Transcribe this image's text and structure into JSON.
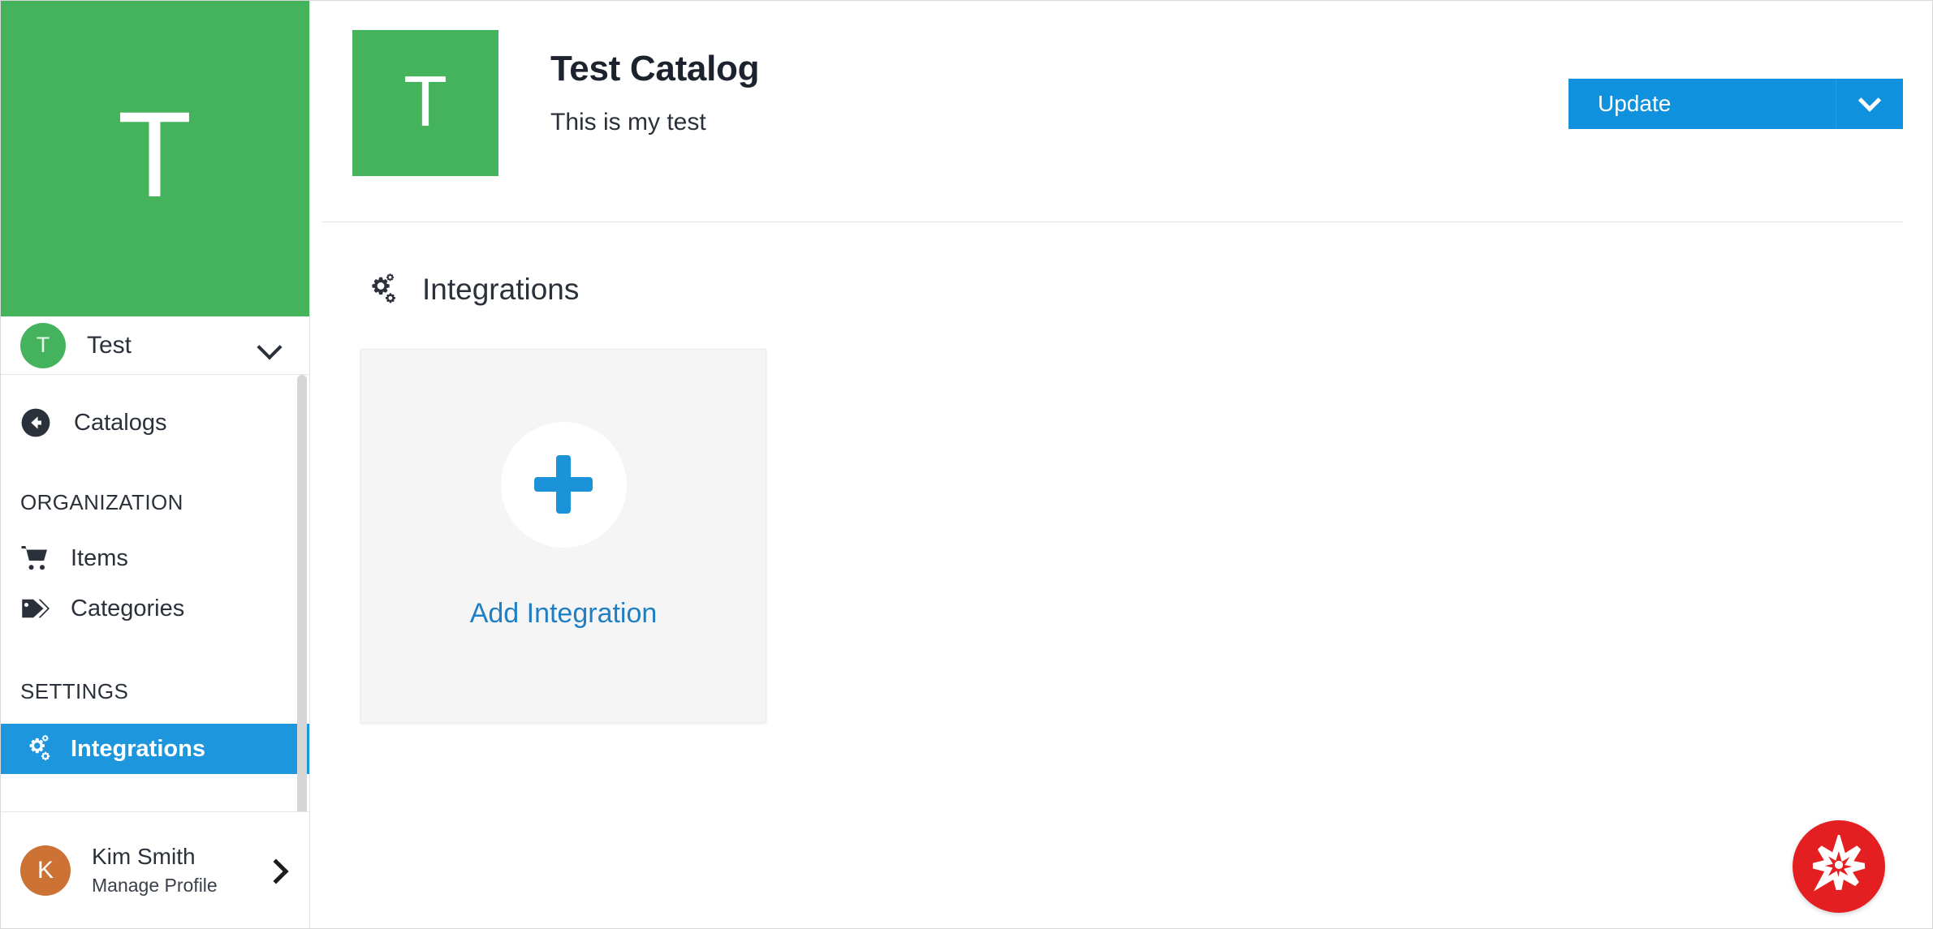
{
  "sidebar": {
    "brand": {
      "letter": "T",
      "color": "#44b35c"
    },
    "org_switcher": {
      "avatar_letter": "T",
      "avatar_color": "#45b35d",
      "name": "Test",
      "chevron_icon": "chevron-down-icon"
    },
    "back_item": {
      "label": "Catalogs",
      "icon": "arrow-circle-left-icon"
    },
    "sections": [
      {
        "title": "ORGANIZATION",
        "items": [
          {
            "label": "Items",
            "icon": "shopping-cart-icon",
            "active": false
          },
          {
            "label": "Categories",
            "icon": "tags-icon",
            "active": false
          }
        ]
      },
      {
        "title": "SETTINGS",
        "items": [
          {
            "label": "Integrations",
            "icon": "gears-icon",
            "active": true
          }
        ]
      }
    ],
    "active_item_color": "#1d96dd",
    "user": {
      "avatar_letter": "K",
      "avatar_color": "#cd7235",
      "name": "Kim Smith",
      "subtitle": "Manage Profile",
      "chevron_icon": "chevron-right-icon"
    },
    "scrollbar": {
      "name": "sidebar-scrollbar"
    }
  },
  "header": {
    "thumbnail_letter": "T",
    "thumbnail_color": "#44b35c",
    "title": "Test Catalog",
    "subtitle": "This is my test",
    "update_button": {
      "label": "Update",
      "color": "#1091de",
      "chevron_icon": "chevron-down-icon"
    }
  },
  "main": {
    "section": {
      "icon": "gears-icon",
      "title": "Integrations"
    },
    "add_card": {
      "label": "Add Integration",
      "plus_icon": "plus-icon",
      "accent_color": "#1f7fc4",
      "background": "#f5f5f5"
    },
    "fab": {
      "icon": "asterisk-burst-icon",
      "color": "#e41f21"
    }
  }
}
